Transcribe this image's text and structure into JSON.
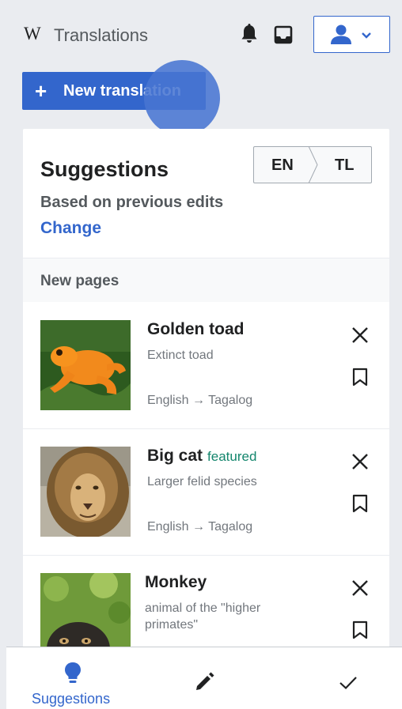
{
  "header": {
    "logo": "W",
    "title": "Translations",
    "icons": [
      "bell-icon",
      "inbox-icon",
      "user-icon",
      "chevron-down-icon"
    ]
  },
  "new_translation": {
    "plus": "+",
    "label": "New translation"
  },
  "suggestions": {
    "title": "Suggestions",
    "source_lang": "EN",
    "target_lang": "TL",
    "based_on": "Based on previous edits",
    "change_label": "Change",
    "section_label": "New pages",
    "items": [
      {
        "title": "Golden toad",
        "badge": "",
        "description": "Extinct toad",
        "from": "English",
        "to": "Tagalog"
      },
      {
        "title": "Big cat",
        "badge": "featured",
        "description": "Larger felid species",
        "from": "English",
        "to": "Tagalog"
      },
      {
        "title": "Monkey",
        "badge": "",
        "description": "animal of the \"higher primates\"",
        "from": "",
        "to": ""
      }
    ]
  },
  "bottom_nav": {
    "items": [
      {
        "label": "Suggestions",
        "icon": "lightbulb-icon",
        "active": true
      },
      {
        "label": "",
        "icon": "pencil-icon",
        "active": false
      },
      {
        "label": "",
        "icon": "checkmark-icon",
        "active": false
      }
    ]
  },
  "colors": {
    "accent": "#3366cc",
    "featured": "#14866d",
    "background": "#eaecf0"
  }
}
